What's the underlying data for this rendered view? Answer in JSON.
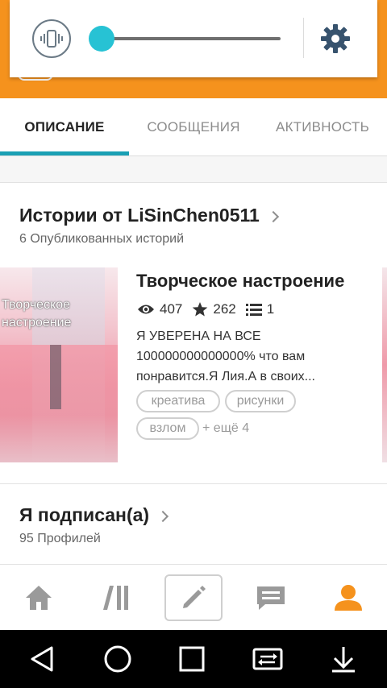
{
  "quick_panel": {
    "vibrate_icon": "vibrate-icon",
    "volume_level": 0.04,
    "settings_icon": "gear-icon",
    "accent_color": "#27c2d4"
  },
  "header": {
    "color": "#f5921d"
  },
  "tabs": [
    {
      "label": "ОПИСАНИЕ",
      "active": true
    },
    {
      "label": "СООБЩЕНИЯ",
      "active": false
    },
    {
      "label": "АКТИВНОСТЬ",
      "active": false
    }
  ],
  "stories": {
    "title": "Истории от LiSinChen0511",
    "subtitle": "6 Опубликованных историй",
    "items": [
      {
        "cover_text": "Творческое\nнастроение",
        "title": "Творческое настроение",
        "reads": "407",
        "votes": "262",
        "parts": "1",
        "description": "Я УВЕРЕНА НА ВСЕ 100000000000000% что вам понравится.Я Лия.А в своих...",
        "tags": [
          "креатива",
          "рисунки",
          "взлом"
        ],
        "more_tags": "+ ещё 4"
      }
    ]
  },
  "following": {
    "title": "Я подписан(а)",
    "subtitle": "95 Профилей"
  },
  "bottom_nav": [
    {
      "icon": "home-icon"
    },
    {
      "icon": "library-icon"
    },
    {
      "icon": "pencil-icon"
    },
    {
      "icon": "messages-icon"
    },
    {
      "icon": "profile-icon",
      "active": true,
      "active_color": "#f5921d"
    }
  ],
  "system_nav": [
    {
      "icon": "back-icon"
    },
    {
      "icon": "home-circle-icon"
    },
    {
      "icon": "recents-icon"
    },
    {
      "icon": "dual-window-icon"
    },
    {
      "icon": "notification-download-icon"
    }
  ]
}
